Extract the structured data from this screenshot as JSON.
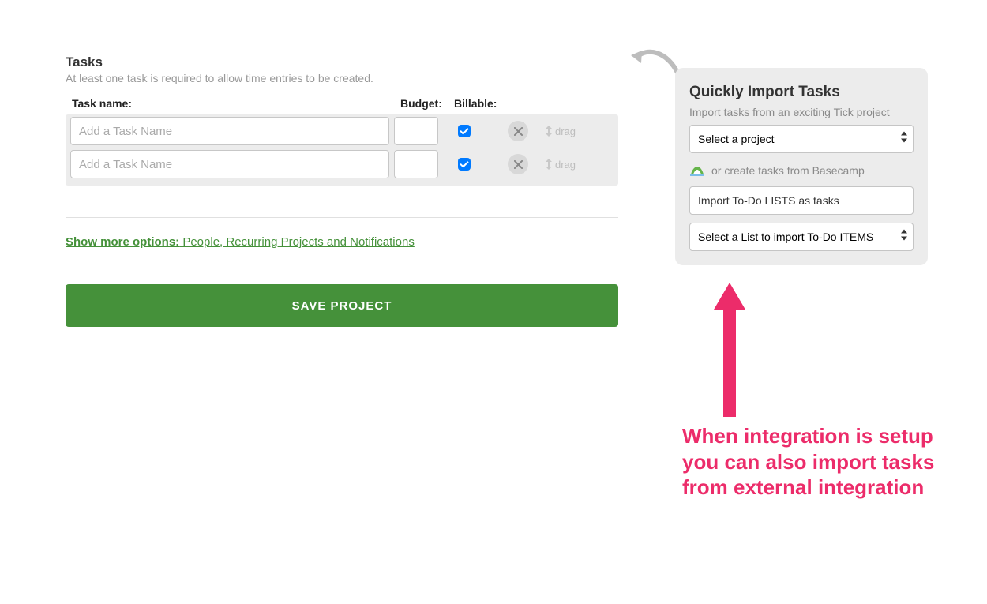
{
  "tasks_section": {
    "title": "Tasks",
    "subtitle": "At least one task is required to allow time entries to be created.",
    "col_name_label": "Task name:",
    "col_budget_label": "Budget:",
    "col_billable_label": "Billable:",
    "rows": [
      {
        "name_placeholder": "Add a Task Name",
        "budget": "",
        "billable": true,
        "drag_label": "drag"
      },
      {
        "name_placeholder": "Add a Task Name",
        "budget": "",
        "billable": true,
        "drag_label": "drag"
      }
    ]
  },
  "more_options": {
    "label_bold": "Show more options:",
    "label_rest": " People, Recurring Projects and Notifications"
  },
  "save_button_label": "SAVE PROJECT",
  "import_card": {
    "title": "Quickly Import Tasks",
    "subtitle": "Import tasks from an exciting Tick project",
    "project_select_label": "Select a project",
    "basecamp_label": "or create tasks from Basecamp",
    "import_lists_value": "Import To-Do LISTS as tasks",
    "list_select_label": "Select a List to import To-Do ITEMS"
  },
  "annotation_text": "When integration is setup you can also import tasks from external integration",
  "colors": {
    "accent_green": "#45913a",
    "annotation_pink": "#ec2c6a",
    "checkbox_blue": "#007aff"
  }
}
